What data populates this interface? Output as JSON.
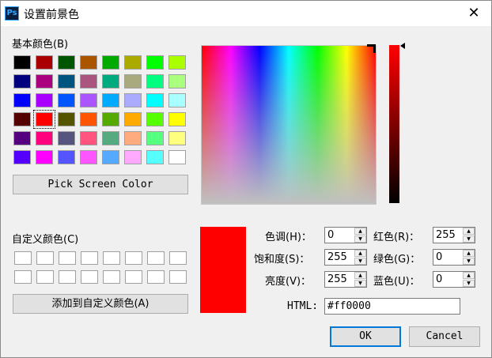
{
  "window": {
    "title": "设置前景色",
    "app_icon_text": "Ps",
    "close_glyph": "✕"
  },
  "basic_colors": {
    "label": "基本颜色(B)",
    "swatches": [
      "#000000",
      "#aa0000",
      "#005500",
      "#aa5500",
      "#00aa00",
      "#aaaa00",
      "#00ff00",
      "#aaff00",
      "#00007f",
      "#aa007f",
      "#00557f",
      "#aa557f",
      "#00aa7f",
      "#aaaa7f",
      "#00ff7f",
      "#aaff7f",
      "#0000ff",
      "#aa00ff",
      "#0055ff",
      "#aa55ff",
      "#00aaff",
      "#aaaaff",
      "#00ffff",
      "#aaffff",
      "#550000",
      "#ff0000",
      "#555500",
      "#ff5500",
      "#55aa00",
      "#ffaa00",
      "#55ff00",
      "#ffff00",
      "#55007f",
      "#ff007f",
      "#55557f",
      "#ff557f",
      "#55aa7f",
      "#ffaa7f",
      "#55ff7f",
      "#ffff7f",
      "#5500ff",
      "#ff00ff",
      "#5555ff",
      "#ff55ff",
      "#55aaff",
      "#ffaaff",
      "#55ffff",
      "#ffffff"
    ],
    "selected_index": 25
  },
  "pick_screen_color_label": "Pick Screen Color",
  "custom_colors": {
    "label": "自定义颜色(C)",
    "count": 16
  },
  "add_custom_label": "添加到自定义颜色(A)",
  "current_color": "#ff0000",
  "fields": {
    "hue": {
      "label": "色调(H)：",
      "value": "0"
    },
    "saturation": {
      "label": "饱和度(S)：",
      "value": "255"
    },
    "value": {
      "label": "亮度(V)：",
      "value": "255"
    },
    "red": {
      "label": "红色(R)：",
      "value": "255"
    },
    "green": {
      "label": "绿色(G)：",
      "value": "0"
    },
    "blue": {
      "label": "蓝色(U)：",
      "value": "0"
    }
  },
  "html": {
    "label": "HTML:",
    "value": "#ff0000"
  },
  "buttons": {
    "ok": "OK",
    "cancel": "Cancel"
  }
}
